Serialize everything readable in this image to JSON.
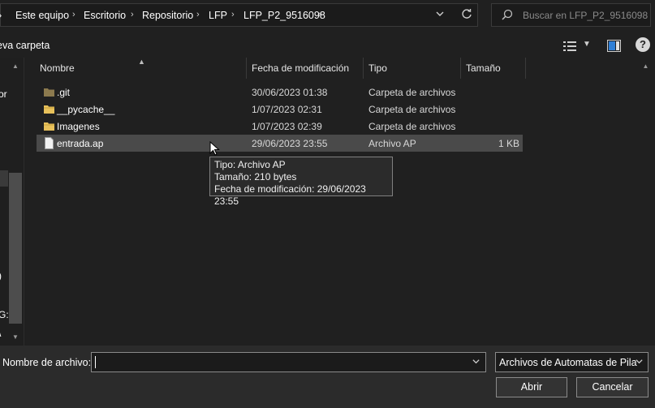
{
  "address": {
    "crumbs": [
      "Este equipo",
      "Escritorio",
      "Repositorio",
      "LFP",
      "LFP_P2_9516098"
    ],
    "separator": "›",
    "dropdown_icon": "chevron-down-icon",
    "refresh_icon": "refresh-icon"
  },
  "search": {
    "placeholder": "Buscar en LFP_P2_9516098"
  },
  "toolbar": {
    "new_folder": "eva carpeta"
  },
  "nav": {
    "fragments": [
      "or",
      ")",
      "G:",
      "\\"
    ]
  },
  "columns": {
    "name": "Nombre",
    "date": "Fecha de modificación",
    "type": "Tipo",
    "size": "Tamaño"
  },
  "files": [
    {
      "name": ".git",
      "date": "30/06/2023 01:38",
      "type": "Carpeta de archivos",
      "size": "",
      "icon": "folder-icon"
    },
    {
      "name": "__pycache__",
      "date": "1/07/2023 02:31",
      "type": "Carpeta de archivos",
      "size": "",
      "icon": "folder-icon"
    },
    {
      "name": "Imagenes",
      "date": "1/07/2023 02:39",
      "type": "Carpeta de archivos",
      "size": "",
      "icon": "folder-icon"
    },
    {
      "name": "entrada.ap",
      "date": "29/06/2023 23:55",
      "type": "Archivo AP",
      "size": "1 KB",
      "icon": "file-icon"
    }
  ],
  "tooltip": {
    "line1": "Tipo: Archivo AP",
    "line2": "Tamaño: 210 bytes",
    "line3": "Fecha de modificación: 29/06/2023 23:55"
  },
  "bottom": {
    "filename_label": "Nombre de archivo:",
    "filename_value": "",
    "filter": "Archivos de Automatas de Pila",
    "open": "Abrir",
    "cancel": "Cancelar"
  },
  "colors": {
    "background": "#202020",
    "selection": "#4a4a4a",
    "folder": "#e8c15b",
    "accent_text": "#ffffff"
  }
}
